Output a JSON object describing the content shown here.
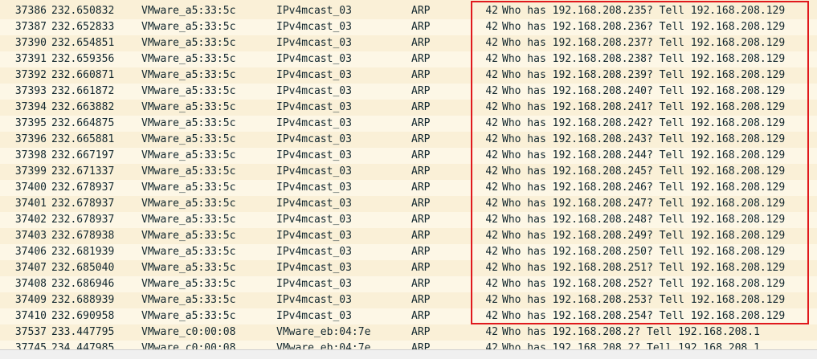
{
  "packets": [
    {
      "no": "37386",
      "time": "232.650832",
      "source": "VMware_a5:33:5c",
      "destination": "IPv4mcast_03",
      "protocol": "ARP",
      "length": "42",
      "info": "Who has 192.168.208.235? Tell 192.168.208.129"
    },
    {
      "no": "37387",
      "time": "232.652833",
      "source": "VMware_a5:33:5c",
      "destination": "IPv4mcast_03",
      "protocol": "ARP",
      "length": "42",
      "info": "Who has 192.168.208.236? Tell 192.168.208.129"
    },
    {
      "no": "37390",
      "time": "232.654851",
      "source": "VMware_a5:33:5c",
      "destination": "IPv4mcast_03",
      "protocol": "ARP",
      "length": "42",
      "info": "Who has 192.168.208.237? Tell 192.168.208.129"
    },
    {
      "no": "37391",
      "time": "232.659356",
      "source": "VMware_a5:33:5c",
      "destination": "IPv4mcast_03",
      "protocol": "ARP",
      "length": "42",
      "info": "Who has 192.168.208.238? Tell 192.168.208.129"
    },
    {
      "no": "37392",
      "time": "232.660871",
      "source": "VMware_a5:33:5c",
      "destination": "IPv4mcast_03",
      "protocol": "ARP",
      "length": "42",
      "info": "Who has 192.168.208.239? Tell 192.168.208.129"
    },
    {
      "no": "37393",
      "time": "232.661872",
      "source": "VMware_a5:33:5c",
      "destination": "IPv4mcast_03",
      "protocol": "ARP",
      "length": "42",
      "info": "Who has 192.168.208.240? Tell 192.168.208.129"
    },
    {
      "no": "37394",
      "time": "232.663882",
      "source": "VMware_a5:33:5c",
      "destination": "IPv4mcast_03",
      "protocol": "ARP",
      "length": "42",
      "info": "Who has 192.168.208.241? Tell 192.168.208.129"
    },
    {
      "no": "37395",
      "time": "232.664875",
      "source": "VMware_a5:33:5c",
      "destination": "IPv4mcast_03",
      "protocol": "ARP",
      "length": "42",
      "info": "Who has 192.168.208.242? Tell 192.168.208.129"
    },
    {
      "no": "37396",
      "time": "232.665881",
      "source": "VMware_a5:33:5c",
      "destination": "IPv4mcast_03",
      "protocol": "ARP",
      "length": "42",
      "info": "Who has 192.168.208.243? Tell 192.168.208.129"
    },
    {
      "no": "37398",
      "time": "232.667197",
      "source": "VMware_a5:33:5c",
      "destination": "IPv4mcast_03",
      "protocol": "ARP",
      "length": "42",
      "info": "Who has 192.168.208.244? Tell 192.168.208.129"
    },
    {
      "no": "37399",
      "time": "232.671337",
      "source": "VMware_a5:33:5c",
      "destination": "IPv4mcast_03",
      "protocol": "ARP",
      "length": "42",
      "info": "Who has 192.168.208.245? Tell 192.168.208.129"
    },
    {
      "no": "37400",
      "time": "232.678937",
      "source": "VMware_a5:33:5c",
      "destination": "IPv4mcast_03",
      "protocol": "ARP",
      "length": "42",
      "info": "Who has 192.168.208.246? Tell 192.168.208.129"
    },
    {
      "no": "37401",
      "time": "232.678937",
      "source": "VMware_a5:33:5c",
      "destination": "IPv4mcast_03",
      "protocol": "ARP",
      "length": "42",
      "info": "Who has 192.168.208.247? Tell 192.168.208.129"
    },
    {
      "no": "37402",
      "time": "232.678937",
      "source": "VMware_a5:33:5c",
      "destination": "IPv4mcast_03",
      "protocol": "ARP",
      "length": "42",
      "info": "Who has 192.168.208.248? Tell 192.168.208.129"
    },
    {
      "no": "37403",
      "time": "232.678938",
      "source": "VMware_a5:33:5c",
      "destination": "IPv4mcast_03",
      "protocol": "ARP",
      "length": "42",
      "info": "Who has 192.168.208.249? Tell 192.168.208.129"
    },
    {
      "no": "37406",
      "time": "232.681939",
      "source": "VMware_a5:33:5c",
      "destination": "IPv4mcast_03",
      "protocol": "ARP",
      "length": "42",
      "info": "Who has 192.168.208.250? Tell 192.168.208.129"
    },
    {
      "no": "37407",
      "time": "232.685040",
      "source": "VMware_a5:33:5c",
      "destination": "IPv4mcast_03",
      "protocol": "ARP",
      "length": "42",
      "info": "Who has 192.168.208.251? Tell 192.168.208.129"
    },
    {
      "no": "37408",
      "time": "232.686946",
      "source": "VMware_a5:33:5c",
      "destination": "IPv4mcast_03",
      "protocol": "ARP",
      "length": "42",
      "info": "Who has 192.168.208.252? Tell 192.168.208.129"
    },
    {
      "no": "37409",
      "time": "232.688939",
      "source": "VMware_a5:33:5c",
      "destination": "IPv4mcast_03",
      "protocol": "ARP",
      "length": "42",
      "info": "Who has 192.168.208.253? Tell 192.168.208.129"
    },
    {
      "no": "37410",
      "time": "232.690958",
      "source": "VMware_a5:33:5c",
      "destination": "IPv4mcast_03",
      "protocol": "ARP",
      "length": "42",
      "info": "Who has 192.168.208.254? Tell 192.168.208.129"
    },
    {
      "no": "37537",
      "time": "233.447795",
      "source": "VMware_c0:00:08",
      "destination": "VMware_eb:04:7e",
      "protocol": "ARP",
      "length": "42",
      "info": "Who has 192.168.208.2? Tell 192.168.208.1"
    },
    {
      "no": "37745",
      "time": "234.447985",
      "source": "VMware_c0:00:08",
      "destination": "VMware_eb:04:7e",
      "protocol": "ARP",
      "length": "42",
      "info": "Who has 192.168.208.2? Tell 192.168.208.1"
    }
  ],
  "colors": {
    "row_background": "#faf0d7",
    "text": "#12272e",
    "highlight_border": "#e0191d"
  }
}
